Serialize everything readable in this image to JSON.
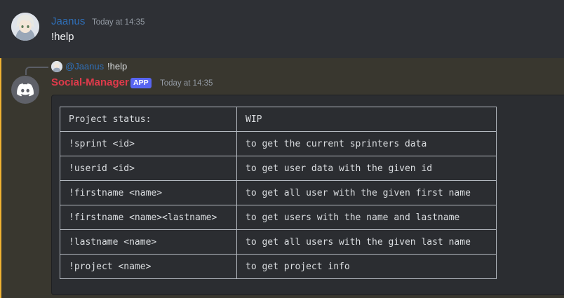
{
  "first_message": {
    "username": "Jaanus",
    "timestamp": "Today at 14:35",
    "content": "!help"
  },
  "reply_preview": {
    "mention": "@Jaanus",
    "content": "!help"
  },
  "bot_message": {
    "username": "Social-Manager",
    "badge": "APP",
    "timestamp": "Today at 14:35"
  },
  "help_table": {
    "rows": [
      {
        "command": "Project status:",
        "description": "WIP"
      },
      {
        "command": "!sprint <id>",
        "description": "to get the current sprinters data"
      },
      {
        "command": "!userid <id>",
        "description": "to get user data with the given id"
      },
      {
        "command": "!firstname <name>",
        "description": "to get all user with the given first name"
      },
      {
        "command": "!firstname <name><lastname>",
        "description": "to get users with the name and lastname"
      },
      {
        "command": "!lastname <name>",
        "description": "to get all users with the given last name"
      },
      {
        "command": "!project <name>",
        "description": "to get project info"
      }
    ]
  },
  "colors": {
    "background": "#313338",
    "mention_highlight": "#39372f",
    "mention_bar": "#f0b232",
    "user_name": "#2f6fb8",
    "bot_name": "#e03a4b",
    "app_badge": "#5865f2"
  },
  "icons": {
    "user_avatar": "anime-avatar-icon",
    "bot_avatar": "discord-logo-icon"
  }
}
